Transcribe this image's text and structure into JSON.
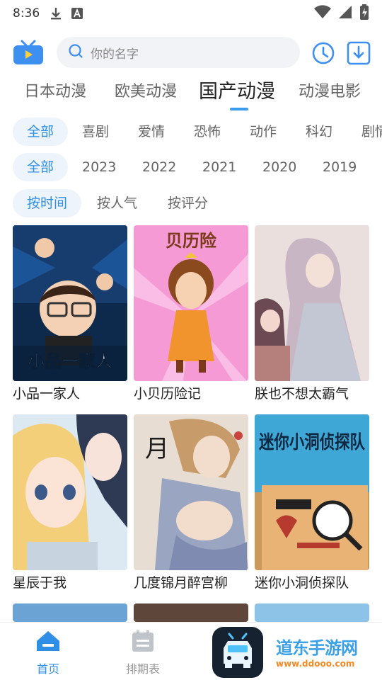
{
  "status": {
    "time": "8:36"
  },
  "header": {
    "search_placeholder": "你的名字"
  },
  "category_tabs": [
    "日本动漫",
    "欧美动漫",
    "国产动漫",
    "动漫电影"
  ],
  "active_category": "国产动漫",
  "genre_filters": [
    "全部",
    "喜剧",
    "爱情",
    "恐怖",
    "动作",
    "科幻",
    "剧情"
  ],
  "year_filters": [
    "全部",
    "2023",
    "2022",
    "2021",
    "2020",
    "2019"
  ],
  "sort_filters": [
    "按时间",
    "按人气",
    "按评分"
  ],
  "cards": [
    {
      "title": "小品一家人",
      "cover_text": "小品一家人"
    },
    {
      "title": "小贝历险记",
      "cover_text": "贝历险"
    },
    {
      "title": "朕也不想太霸气"
    },
    {
      "title": "星辰于我"
    },
    {
      "title": "几度锦月醉宫柳",
      "cover_text": "月"
    },
    {
      "title": "迷你小洞侦探队",
      "cover_text": "迷你小洞侦探队"
    }
  ],
  "bottom_nav": {
    "home": "首页",
    "schedule": "排期表"
  },
  "watermark": {
    "name": "道东手游网",
    "url": "www.ddooo.com"
  },
  "colors": {
    "accent": "#3b9ded",
    "chip_bg": "#eef4fb"
  }
}
